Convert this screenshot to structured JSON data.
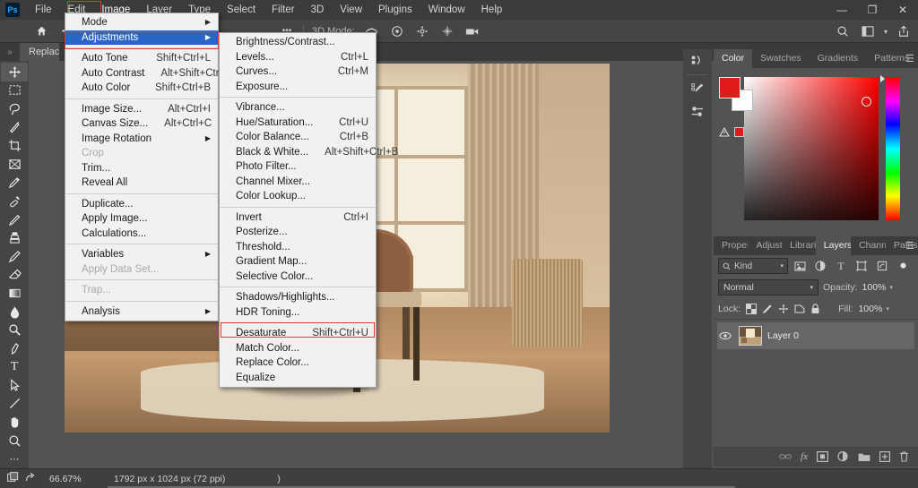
{
  "app": {
    "name": "Adobe Photoshop",
    "logo_text": "Ps"
  },
  "titlebar": {
    "menus": [
      {
        "label": "File"
      },
      {
        "label": "Edit"
      },
      {
        "label": "Image",
        "highlighted": true
      },
      {
        "label": "Layer"
      },
      {
        "label": "Type"
      },
      {
        "label": "Select"
      },
      {
        "label": "Filter"
      },
      {
        "label": "3D"
      },
      {
        "label": "View"
      },
      {
        "label": "Plugins"
      },
      {
        "label": "Window"
      },
      {
        "label": "Help"
      }
    ],
    "window_controls": [
      {
        "name": "minimize",
        "glyph": "—"
      },
      {
        "name": "restore",
        "glyph": "❐"
      },
      {
        "name": "close",
        "glyph": "✕"
      }
    ]
  },
  "options_bar": {
    "overflow_glyph": "•••",
    "mode_label": "3D Mode:",
    "mode_icons": [
      "orbit-3d-icon",
      "roll-3d-icon",
      "pan-3d-icon",
      "slide-3d-icon",
      "camera-3d-icon"
    ],
    "right_icons": [
      "search-icon",
      "workspace-icon",
      "share-icon"
    ],
    "workspace_chevron": "▾"
  },
  "doc_tab": {
    "label": "Replace",
    "collapse_glyph": "»"
  },
  "toolbar": {
    "home_icon": "home-icon",
    "tools": [
      {
        "name": "move-tool",
        "selected": true
      },
      {
        "name": "rectangular-marquee-tool"
      },
      {
        "name": "lasso-tool"
      },
      {
        "name": "object-selection-tool"
      },
      {
        "name": "crop-tool"
      },
      {
        "name": "frame-tool"
      },
      {
        "name": "eyedropper-tool"
      },
      {
        "name": "healing-brush-tool"
      },
      {
        "name": "brush-tool"
      },
      {
        "name": "clone-stamp-tool"
      },
      {
        "name": "history-brush-tool"
      },
      {
        "name": "eraser-tool"
      },
      {
        "name": "gradient-tool"
      },
      {
        "name": "blur-tool"
      },
      {
        "name": "dodge-tool"
      },
      {
        "name": "pen-tool"
      },
      {
        "name": "type-tool"
      },
      {
        "name": "path-selection-tool"
      },
      {
        "name": "line-shape-tool"
      },
      {
        "name": "hand-tool"
      },
      {
        "name": "zoom-tool"
      },
      {
        "name": "edit-toolbar-tool"
      }
    ]
  },
  "image_menu": {
    "items": [
      {
        "label": "Mode",
        "submenu": true
      },
      {
        "label": "Adjustments",
        "submenu": true,
        "highlighted": true
      },
      {
        "separator": true
      },
      {
        "label": "Auto Tone",
        "shortcut": "Shift+Ctrl+L"
      },
      {
        "label": "Auto Contrast",
        "shortcut": "Alt+Shift+Ctrl+L"
      },
      {
        "label": "Auto Color",
        "shortcut": "Shift+Ctrl+B"
      },
      {
        "separator": true
      },
      {
        "label": "Image Size...",
        "shortcut": "Alt+Ctrl+I"
      },
      {
        "label": "Canvas Size...",
        "shortcut": "Alt+Ctrl+C"
      },
      {
        "label": "Image Rotation",
        "submenu": true
      },
      {
        "label": "Crop",
        "disabled": true
      },
      {
        "label": "Trim..."
      },
      {
        "label": "Reveal All"
      },
      {
        "separator": true
      },
      {
        "label": "Duplicate..."
      },
      {
        "label": "Apply Image..."
      },
      {
        "label": "Calculations..."
      },
      {
        "separator": true
      },
      {
        "label": "Variables",
        "submenu": true
      },
      {
        "label": "Apply Data Set...",
        "disabled": true
      },
      {
        "separator": true
      },
      {
        "label": "Trap...",
        "disabled": true
      },
      {
        "separator": true
      },
      {
        "label": "Analysis",
        "submenu": true
      }
    ]
  },
  "adjustments_menu": {
    "items": [
      {
        "label": "Brightness/Contrast..."
      },
      {
        "label": "Levels...",
        "shortcut": "Ctrl+L"
      },
      {
        "label": "Curves...",
        "shortcut": "Ctrl+M"
      },
      {
        "label": "Exposure..."
      },
      {
        "separator": true
      },
      {
        "label": "Vibrance..."
      },
      {
        "label": "Hue/Saturation...",
        "shortcut": "Ctrl+U"
      },
      {
        "label": "Color Balance...",
        "shortcut": "Ctrl+B"
      },
      {
        "label": "Black & White...",
        "shortcut": "Alt+Shift+Ctrl+B"
      },
      {
        "label": "Photo Filter..."
      },
      {
        "label": "Channel Mixer..."
      },
      {
        "label": "Color Lookup..."
      },
      {
        "separator": true
      },
      {
        "label": "Invert",
        "shortcut": "Ctrl+I"
      },
      {
        "label": "Posterize..."
      },
      {
        "label": "Threshold..."
      },
      {
        "label": "Gradient Map..."
      },
      {
        "label": "Selective Color..."
      },
      {
        "separator": true
      },
      {
        "label": "Shadows/Highlights..."
      },
      {
        "label": "HDR Toning..."
      },
      {
        "separator": true
      },
      {
        "label": "Desaturate",
        "shortcut": "Shift+Ctrl+U"
      },
      {
        "label": "Match Color..."
      },
      {
        "label": "Replace Color...",
        "annotated": true
      },
      {
        "label": "Equalize"
      }
    ]
  },
  "annotations": {
    "accent_color": "#e03a35",
    "shapes": [
      "menu-image-box",
      "adjustments-box",
      "replace-color-box",
      "arrow-to-chair",
      "ellipse-on-chair"
    ]
  },
  "color_panel": {
    "tabs": [
      {
        "label": "Color",
        "active": true
      },
      {
        "label": "Swatches"
      },
      {
        "label": "Gradients"
      },
      {
        "label": "Patterns"
      }
    ],
    "foreground_color": "#e01b1b",
    "background_color": "#ffffff",
    "gamut_warning_icon": "gamut-warning-icon",
    "menu_glyph": "☰"
  },
  "layers_panel": {
    "tabs": [
      {
        "label": "Propei"
      },
      {
        "label": "Adjust"
      },
      {
        "label": "Librari"
      },
      {
        "label": "Layers",
        "active": true
      },
      {
        "label": "Chann"
      },
      {
        "label": "Paths"
      }
    ],
    "menu_glyph": "☰",
    "filter": {
      "kind_label": "Kind",
      "search_icon": "search-icon",
      "chevron": "▾",
      "icons": [
        "pixel-filter-icon",
        "adjustment-filter-icon",
        "type-filter-icon",
        "shape-filter-icon",
        "smart-object-filter-icon",
        "filter-toggle-icon"
      ]
    },
    "blend_mode": "Normal",
    "blend_chevron": "▾",
    "opacity_label": "Opacity:",
    "opacity_value": "100%",
    "lock_label": "Lock:",
    "lock_icons": [
      "lock-transparency-icon",
      "lock-image-icon",
      "lock-position-icon",
      "lock-artboard-icon",
      "lock-all-icon"
    ],
    "fill_label": "Fill:",
    "fill_value": "100%",
    "layers": [
      {
        "name": "Layer 0",
        "visible": true,
        "thumbnail": "room-interior-thumb"
      }
    ],
    "footer_icons": [
      {
        "name": "link-layers-icon",
        "glyph": "⚭",
        "dim": true
      },
      {
        "name": "layer-style-fx-icon",
        "glyph": "fx"
      },
      {
        "name": "add-layer-mask-icon"
      },
      {
        "name": "new-adjustment-layer-icon"
      },
      {
        "name": "new-group-icon"
      },
      {
        "name": "new-layer-icon"
      },
      {
        "name": "delete-layer-icon"
      }
    ]
  },
  "right_rail": {
    "buttons": [
      "libraries-icon",
      "adjustments-icon",
      "properties-icon"
    ]
  },
  "status_bar": {
    "zoom": "66.67%",
    "doc_info": "1792 px x 1024 px (72 ppi)",
    "trailing_paren": ")",
    "icons": [
      "preset-icon",
      "share-icon"
    ]
  }
}
